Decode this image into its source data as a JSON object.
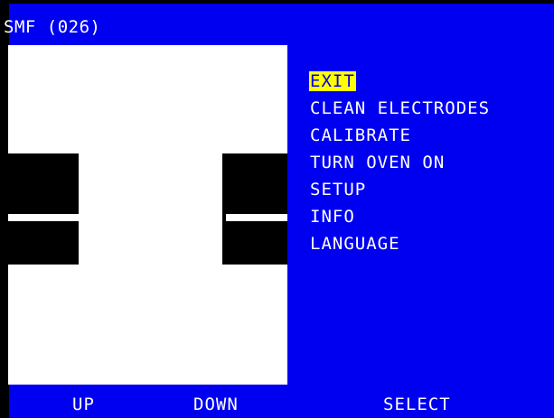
{
  "header": {
    "title": "SMF (026)"
  },
  "menu": {
    "items": [
      {
        "label": "EXIT",
        "selected": true
      },
      {
        "label": "CLEAN ELECTRODES",
        "selected": false
      },
      {
        "label": "CALIBRATE",
        "selected": false
      },
      {
        "label": "TURN OVEN ON",
        "selected": false
      },
      {
        "label": "SETUP",
        "selected": false
      },
      {
        "label": "INFO",
        "selected": false
      },
      {
        "label": "LANGUAGE",
        "selected": false
      }
    ]
  },
  "softkeys": {
    "up": "UP",
    "down": "DOWN",
    "select": "SELECT"
  },
  "colors": {
    "background": "#0000f0",
    "text": "#ffffff",
    "highlight": "#ffff00",
    "viewport": "#ffffff"
  }
}
